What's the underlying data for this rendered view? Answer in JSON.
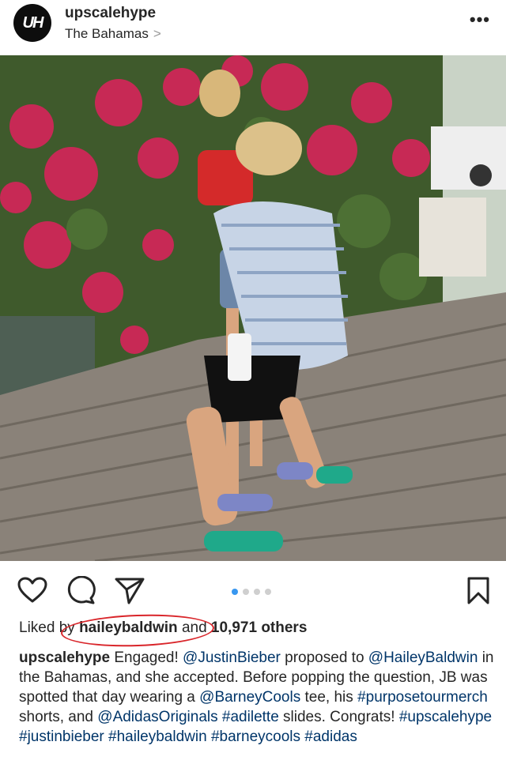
{
  "header": {
    "avatar_text": "UH",
    "username": "upscalehype",
    "location": "The Bahamas",
    "location_chevron": ">",
    "more": "•••"
  },
  "carousel": {
    "count": 4,
    "active": 1
  },
  "likes": {
    "prefix": "Liked by",
    "user": "haileybaldwin",
    "connector": "and",
    "count_text": "10,971 others"
  },
  "caption": {
    "user": "upscalehype",
    "segments": [
      {
        "t": " Engaged! ",
        "link": false
      },
      {
        "t": "@JustinBieber",
        "link": true
      },
      {
        "t": " proposed to ",
        "link": false
      },
      {
        "t": "@HaileyBaldwin",
        "link": true
      },
      {
        "t": " in the Bahamas, and she accepted. Before popping the question, JB was spotted that day wearing a ",
        "link": false
      },
      {
        "t": "@BarneyCools",
        "link": true
      },
      {
        "t": " tee, his ",
        "link": false
      },
      {
        "t": "#purposetourmerch",
        "link": true
      },
      {
        "t": " shorts, and ",
        "link": false
      },
      {
        "t": "@AdidasOriginals",
        "link": true
      },
      {
        "t": " ",
        "link": false
      },
      {
        "t": "#adilette",
        "link": true
      },
      {
        "t": " slides. Congrats! ",
        "link": false
      },
      {
        "t": "#upscalehype",
        "link": true
      },
      {
        "t": " ",
        "link": false
      },
      {
        "t": "#justinbieber",
        "link": true
      },
      {
        "t": " ",
        "link": false
      },
      {
        "t": "#haileybaldwin",
        "link": true
      },
      {
        "t": " ",
        "link": false
      },
      {
        "t": "#barneycools",
        "link": true
      },
      {
        "t": " ",
        "link": false
      },
      {
        "t": "#adidas",
        "link": true
      }
    ]
  },
  "colors": {
    "text": "#262626",
    "link": "#003569",
    "carousel_active": "#3897f0",
    "annotation": "#d9252a"
  },
  "icons": [
    "heart-icon",
    "comment-icon",
    "share-icon",
    "bookmark-icon",
    "more-icon",
    "chevron-right-icon"
  ]
}
